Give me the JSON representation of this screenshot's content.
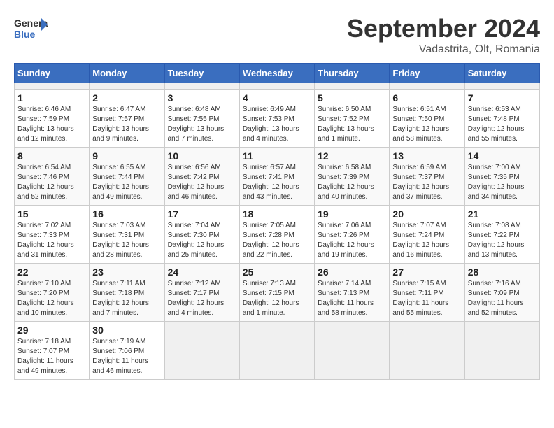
{
  "header": {
    "logo_text_general": "General",
    "logo_text_blue": "Blue",
    "month_title": "September 2024",
    "subtitle": "Vadastrita, Olt, Romania"
  },
  "calendar": {
    "days_of_week": [
      "Sunday",
      "Monday",
      "Tuesday",
      "Wednesday",
      "Thursday",
      "Friday",
      "Saturday"
    ],
    "weeks": [
      [
        {
          "day": "",
          "empty": true
        },
        {
          "day": "",
          "empty": true
        },
        {
          "day": "",
          "empty": true
        },
        {
          "day": "",
          "empty": true
        },
        {
          "day": "",
          "empty": true
        },
        {
          "day": "",
          "empty": true
        },
        {
          "day": "",
          "empty": true
        }
      ],
      [
        {
          "day": "1",
          "sunrise": "Sunrise: 6:46 AM",
          "sunset": "Sunset: 7:59 PM",
          "daylight": "Daylight: 13 hours and 12 minutes."
        },
        {
          "day": "2",
          "sunrise": "Sunrise: 6:47 AM",
          "sunset": "Sunset: 7:57 PM",
          "daylight": "Daylight: 13 hours and 9 minutes."
        },
        {
          "day": "3",
          "sunrise": "Sunrise: 6:48 AM",
          "sunset": "Sunset: 7:55 PM",
          "daylight": "Daylight: 13 hours and 7 minutes."
        },
        {
          "day": "4",
          "sunrise": "Sunrise: 6:49 AM",
          "sunset": "Sunset: 7:53 PM",
          "daylight": "Daylight: 13 hours and 4 minutes."
        },
        {
          "day": "5",
          "sunrise": "Sunrise: 6:50 AM",
          "sunset": "Sunset: 7:52 PM",
          "daylight": "Daylight: 13 hours and 1 minute."
        },
        {
          "day": "6",
          "sunrise": "Sunrise: 6:51 AM",
          "sunset": "Sunset: 7:50 PM",
          "daylight": "Daylight: 12 hours and 58 minutes."
        },
        {
          "day": "7",
          "sunrise": "Sunrise: 6:53 AM",
          "sunset": "Sunset: 7:48 PM",
          "daylight": "Daylight: 12 hours and 55 minutes."
        }
      ],
      [
        {
          "day": "8",
          "sunrise": "Sunrise: 6:54 AM",
          "sunset": "Sunset: 7:46 PM",
          "daylight": "Daylight: 12 hours and 52 minutes."
        },
        {
          "day": "9",
          "sunrise": "Sunrise: 6:55 AM",
          "sunset": "Sunset: 7:44 PM",
          "daylight": "Daylight: 12 hours and 49 minutes."
        },
        {
          "day": "10",
          "sunrise": "Sunrise: 6:56 AM",
          "sunset": "Sunset: 7:42 PM",
          "daylight": "Daylight: 12 hours and 46 minutes."
        },
        {
          "day": "11",
          "sunrise": "Sunrise: 6:57 AM",
          "sunset": "Sunset: 7:41 PM",
          "daylight": "Daylight: 12 hours and 43 minutes."
        },
        {
          "day": "12",
          "sunrise": "Sunrise: 6:58 AM",
          "sunset": "Sunset: 7:39 PM",
          "daylight": "Daylight: 12 hours and 40 minutes."
        },
        {
          "day": "13",
          "sunrise": "Sunrise: 6:59 AM",
          "sunset": "Sunset: 7:37 PM",
          "daylight": "Daylight: 12 hours and 37 minutes."
        },
        {
          "day": "14",
          "sunrise": "Sunrise: 7:00 AM",
          "sunset": "Sunset: 7:35 PM",
          "daylight": "Daylight: 12 hours and 34 minutes."
        }
      ],
      [
        {
          "day": "15",
          "sunrise": "Sunrise: 7:02 AM",
          "sunset": "Sunset: 7:33 PM",
          "daylight": "Daylight: 12 hours and 31 minutes."
        },
        {
          "day": "16",
          "sunrise": "Sunrise: 7:03 AM",
          "sunset": "Sunset: 7:31 PM",
          "daylight": "Daylight: 12 hours and 28 minutes."
        },
        {
          "day": "17",
          "sunrise": "Sunrise: 7:04 AM",
          "sunset": "Sunset: 7:30 PM",
          "daylight": "Daylight: 12 hours and 25 minutes."
        },
        {
          "day": "18",
          "sunrise": "Sunrise: 7:05 AM",
          "sunset": "Sunset: 7:28 PM",
          "daylight": "Daylight: 12 hours and 22 minutes."
        },
        {
          "day": "19",
          "sunrise": "Sunrise: 7:06 AM",
          "sunset": "Sunset: 7:26 PM",
          "daylight": "Daylight: 12 hours and 19 minutes."
        },
        {
          "day": "20",
          "sunrise": "Sunrise: 7:07 AM",
          "sunset": "Sunset: 7:24 PM",
          "daylight": "Daylight: 12 hours and 16 minutes."
        },
        {
          "day": "21",
          "sunrise": "Sunrise: 7:08 AM",
          "sunset": "Sunset: 7:22 PM",
          "daylight": "Daylight: 12 hours and 13 minutes."
        }
      ],
      [
        {
          "day": "22",
          "sunrise": "Sunrise: 7:10 AM",
          "sunset": "Sunset: 7:20 PM",
          "daylight": "Daylight: 12 hours and 10 minutes."
        },
        {
          "day": "23",
          "sunrise": "Sunrise: 7:11 AM",
          "sunset": "Sunset: 7:18 PM",
          "daylight": "Daylight: 12 hours and 7 minutes."
        },
        {
          "day": "24",
          "sunrise": "Sunrise: 7:12 AM",
          "sunset": "Sunset: 7:17 PM",
          "daylight": "Daylight: 12 hours and 4 minutes."
        },
        {
          "day": "25",
          "sunrise": "Sunrise: 7:13 AM",
          "sunset": "Sunset: 7:15 PM",
          "daylight": "Daylight: 12 hours and 1 minute."
        },
        {
          "day": "26",
          "sunrise": "Sunrise: 7:14 AM",
          "sunset": "Sunset: 7:13 PM",
          "daylight": "Daylight: 11 hours and 58 minutes."
        },
        {
          "day": "27",
          "sunrise": "Sunrise: 7:15 AM",
          "sunset": "Sunset: 7:11 PM",
          "daylight": "Daylight: 11 hours and 55 minutes."
        },
        {
          "day": "28",
          "sunrise": "Sunrise: 7:16 AM",
          "sunset": "Sunset: 7:09 PM",
          "daylight": "Daylight: 11 hours and 52 minutes."
        }
      ],
      [
        {
          "day": "29",
          "sunrise": "Sunrise: 7:18 AM",
          "sunset": "Sunset: 7:07 PM",
          "daylight": "Daylight: 11 hours and 49 minutes."
        },
        {
          "day": "30",
          "sunrise": "Sunrise: 7:19 AM",
          "sunset": "Sunset: 7:06 PM",
          "daylight": "Daylight: 11 hours and 46 minutes."
        },
        {
          "day": "",
          "empty": true
        },
        {
          "day": "",
          "empty": true
        },
        {
          "day": "",
          "empty": true
        },
        {
          "day": "",
          "empty": true
        },
        {
          "day": "",
          "empty": true
        }
      ]
    ]
  }
}
